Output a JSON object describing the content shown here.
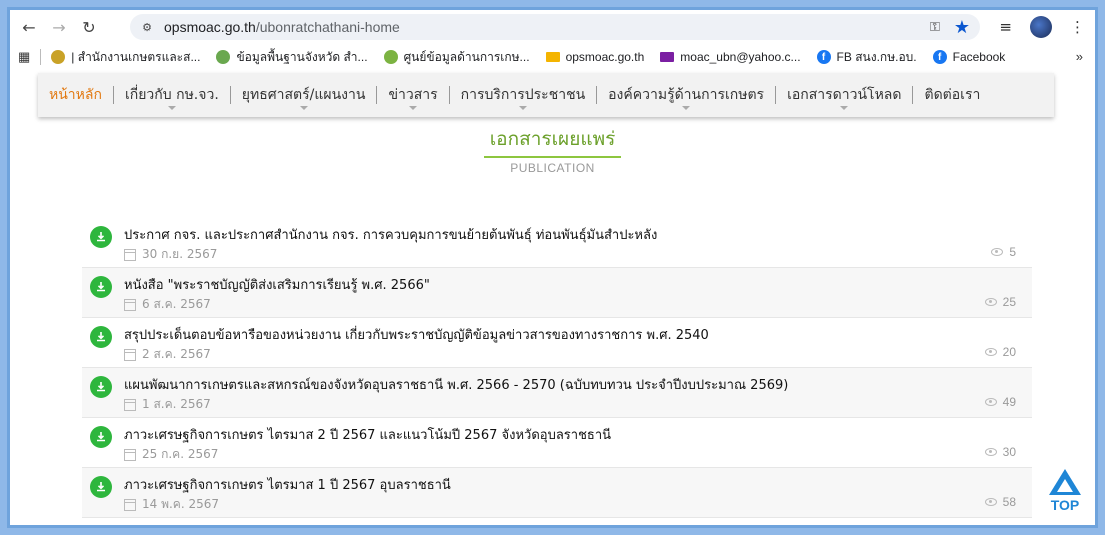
{
  "browser": {
    "url_host": "opsmoac.go.th",
    "url_path": "/ubonratchathani-home",
    "bookmarks": [
      {
        "label": "| สำนักงานเกษตรและส...",
        "color": "#c9a227"
      },
      {
        "label": "ข้อมูลพื้นฐานจังหวัด สำ...",
        "color": "#6aa84f"
      },
      {
        "label": "ศูนย์ข้อมูลด้านการเกษ...",
        "color": "#7cb342"
      },
      {
        "label": "opsmoac.go.th",
        "icon": "mail-icon"
      },
      {
        "label": "moac_ubn@yahoo.c...",
        "icon": "mail-icon"
      },
      {
        "label": "FB สนง.กษ.อบ.",
        "icon": "facebook-icon"
      },
      {
        "label": "Facebook",
        "icon": "facebook-icon"
      }
    ]
  },
  "nav": {
    "items": [
      {
        "label": "หน้าหลัก",
        "active": true,
        "caret": false
      },
      {
        "label": "เกี่ยวกับ กษ.จว.",
        "active": false,
        "caret": true
      },
      {
        "label": "ยุทธศาสตร์/แผนงาน",
        "active": false,
        "caret": true
      },
      {
        "label": "ข่าวสาร",
        "active": false,
        "caret": true
      },
      {
        "label": "การบริการประชาชน",
        "active": false,
        "caret": true
      },
      {
        "label": "องค์ความรู้ด้านการเกษตร",
        "active": false,
        "caret": true
      },
      {
        "label": "เอกสารดาวน์โหลด",
        "active": false,
        "caret": true
      },
      {
        "label": "ติดต่อเรา",
        "active": false,
        "caret": false
      }
    ]
  },
  "section": {
    "title_th": "เอกสารเผยแพร่",
    "title_en": "PUBLICATION"
  },
  "publications": [
    {
      "title": "ประกาศ กจร. และประกาศสำนักงาน กจร. การควบคุมการขนย้ายต้นพันธุ์ ท่อนพันธุ์มันสำปะหลัง",
      "date": "30 ก.ย. 2567",
      "views": "5"
    },
    {
      "title": "หนังสือ \"พระราชบัญญัติส่งเสริมการเรียนรู้ พ.ศ. 2566\"",
      "date": "6 ส.ค. 2567",
      "views": "25"
    },
    {
      "title": "สรุปประเด็นตอบข้อหารือของหน่วยงาน เกี่ยวกับพระราชบัญญัติข้อมูลข่าวสารของทางราชการ พ.ศ. 2540",
      "date": "2 ส.ค. 2567",
      "views": "20"
    },
    {
      "title": "แผนพัฒนาการเกษตรและสหกรณ์ของจังหวัดอุบลราชธานี พ.ศ. 2566 - 2570 (ฉบับทบทวน ประจำปีงบประมาณ 2569)",
      "date": "1 ส.ค. 2567",
      "views": "49"
    },
    {
      "title": "ภาวะเศรษฐกิจการเกษตร ไตรมาส 2 ปี 2567 และแนวโน้มปี 2567 จังหวัดอุบลราชธานี",
      "date": "25 ก.ค. 2567",
      "views": "30"
    },
    {
      "title": "ภาวะเศรษฐกิจการเกษตร ไตรมาส 1 ปี 2567 อุบลราชธานี",
      "date": "14 พ.ค. 2567",
      "views": "58"
    }
  ],
  "top_button": {
    "label": "TOP"
  }
}
